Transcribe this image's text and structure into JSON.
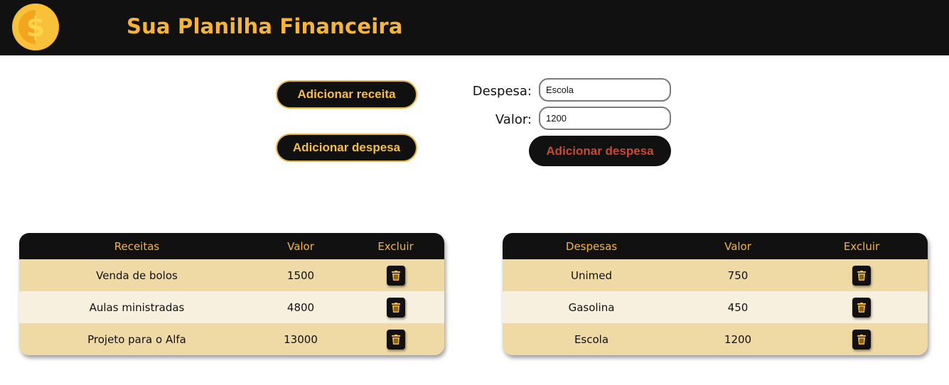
{
  "header": {
    "title": "Sua Planilha Financeira",
    "logo_symbol": "$"
  },
  "actions": {
    "add_receita_label": "Adicionar receita",
    "add_despesa_label": "Adicionar despesa"
  },
  "form": {
    "despesa_label": "Despesa:",
    "despesa_value": "Escola",
    "valor_label": "Valor:",
    "valor_value": "1200",
    "submit_label": "Adicionar despesa"
  },
  "receitas_table": {
    "headers": [
      "Receitas",
      "Valor",
      "Excluir"
    ],
    "rows": [
      {
        "name": "Venda de bolos",
        "value": "1500"
      },
      {
        "name": "Aulas ministradas",
        "value": "4800"
      },
      {
        "name": "Projeto para o Alfa",
        "value": "13000"
      }
    ]
  },
  "despesas_table": {
    "headers": [
      "Despesas",
      "Valor",
      "Excluir"
    ],
    "rows": [
      {
        "name": "Unimed",
        "value": "750"
      },
      {
        "name": "Gasolina",
        "value": "450"
      },
      {
        "name": "Escola",
        "value": "1200"
      }
    ]
  },
  "icons": {
    "logo": "dollar-coin-icon",
    "delete": "trash-icon"
  },
  "colors": {
    "header_bg": "#111111",
    "accent": "#f6b634",
    "submit_text": "#c84a2f",
    "row_dark": "#efdaa6",
    "row_light": "#f7f0df"
  }
}
